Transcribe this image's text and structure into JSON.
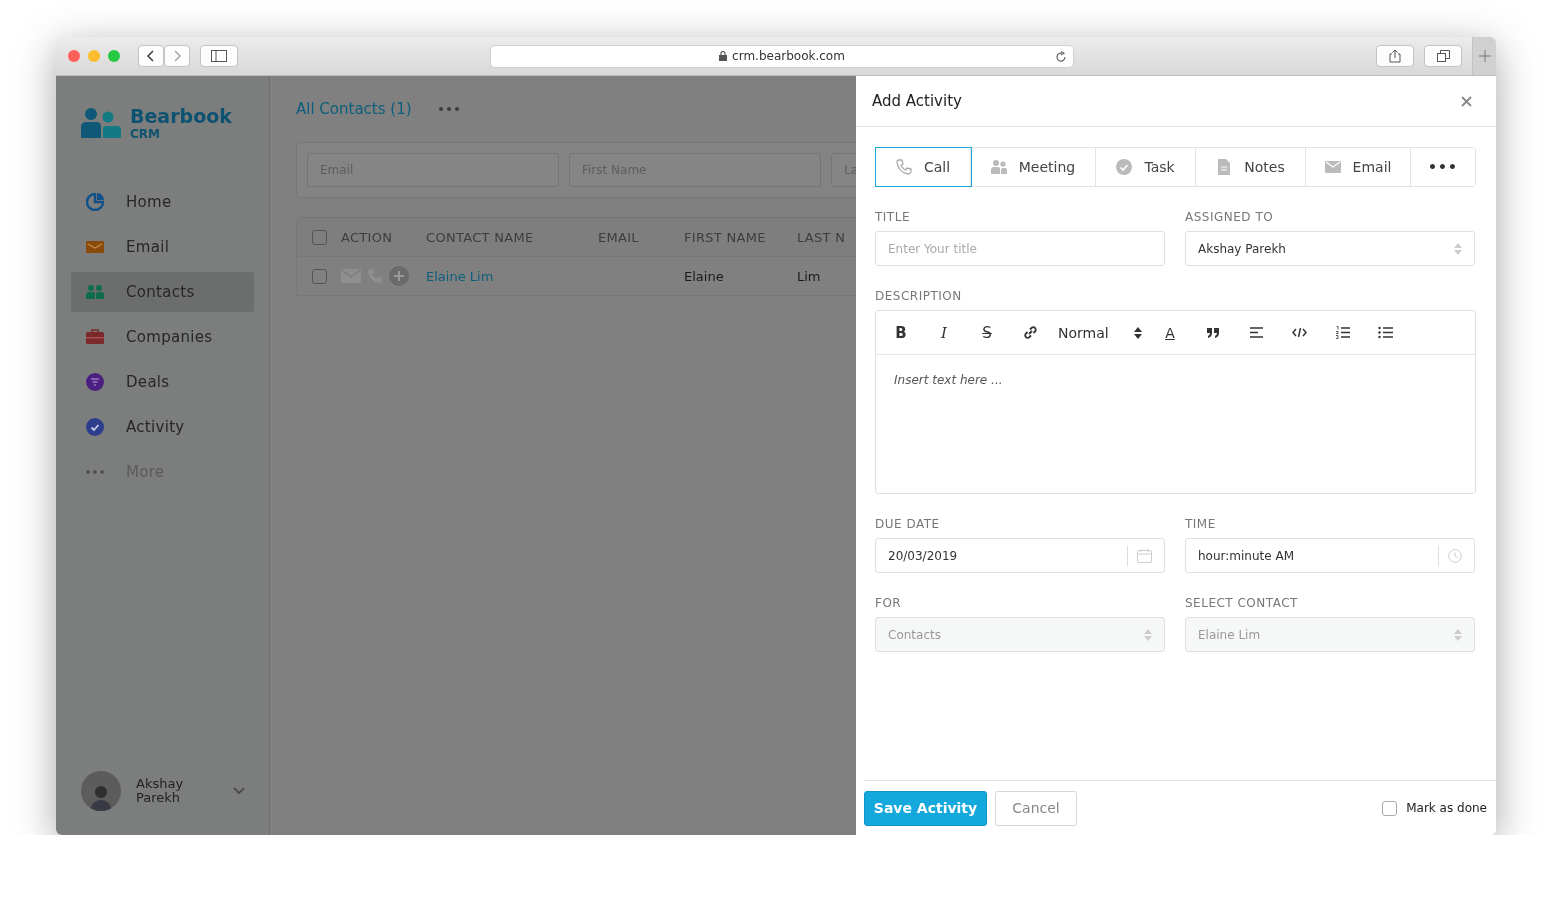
{
  "browser": {
    "url": "crm.bearbook.com"
  },
  "sidebar": {
    "logo": {
      "name": "Bearbook",
      "sub": "CRM"
    },
    "items": [
      {
        "label": "Home",
        "kind": "home",
        "selected": false
      },
      {
        "label": "Email",
        "kind": "email",
        "selected": false
      },
      {
        "label": "Contacts",
        "kind": "contacts",
        "selected": true
      },
      {
        "label": "Companies",
        "kind": "companies",
        "selected": false
      },
      {
        "label": "Deals",
        "kind": "deals",
        "selected": false
      },
      {
        "label": "Activity",
        "kind": "activity",
        "selected": false
      }
    ],
    "more": "More",
    "user": {
      "first": "Akshay",
      "last": "Parekh"
    }
  },
  "main": {
    "heading": "All Contacts (1)",
    "filters": [
      {
        "placeholder": "Email"
      },
      {
        "placeholder": "First Name"
      },
      {
        "placeholder": "La"
      }
    ],
    "table": {
      "select_all_checked": false,
      "columns": [
        "ACTION",
        "CONTACT NAME",
        "EMAIL",
        "FIRST NAME",
        "LAST N"
      ],
      "rows": [
        {
          "checked": false,
          "contact_name": "Elaine Lim",
          "first_name": "Elaine",
          "last_name": "Lim"
        }
      ]
    }
  },
  "panel": {
    "title": "Add Activity",
    "tabs": [
      {
        "label": "Call",
        "kind": "call",
        "selected": true
      },
      {
        "label": "Meeting",
        "kind": "meeting",
        "selected": false
      },
      {
        "label": "Task",
        "kind": "task",
        "selected": false
      },
      {
        "label": "Notes",
        "kind": "notes",
        "selected": false
      },
      {
        "label": "Email",
        "kind": "email",
        "selected": false
      },
      {
        "label": "•••",
        "kind": "more",
        "selected": false
      }
    ],
    "title_field": {
      "label": "TITLE",
      "placeholder": "Enter Your title"
    },
    "assigned_to": {
      "label": "ASSIGNED TO",
      "value": "Akshay Parekh"
    },
    "description": {
      "label": "DESCRIPTION",
      "placeholder": "Insert text here ...",
      "toolbar": [
        {
          "kind": "bold",
          "glyph": "B"
        },
        {
          "kind": "italic",
          "glyph": "I"
        },
        {
          "kind": "strike",
          "glyph": "S"
        },
        {
          "kind": "link"
        },
        {
          "kind": "select",
          "value": "Normal"
        },
        {
          "kind": "color",
          "glyph": "A"
        },
        {
          "kind": "quote"
        },
        {
          "kind": "align"
        },
        {
          "kind": "code"
        },
        {
          "kind": "ordered"
        },
        {
          "kind": "bullet"
        }
      ]
    },
    "due_date": {
      "label": "DUE DATE",
      "value": "20/03/2019"
    },
    "time": {
      "label": "TIME",
      "value": "hour:minute AM"
    },
    "for": {
      "label": "FOR",
      "value": "Contacts",
      "disabled": true
    },
    "select_contact": {
      "label": "SELECT CONTACT",
      "value": "Elaine Lim",
      "disabled": true
    },
    "save": "Save Activity",
    "cancel": "Cancel",
    "mark_done": {
      "label": "Mark as done",
      "checked": false
    }
  }
}
